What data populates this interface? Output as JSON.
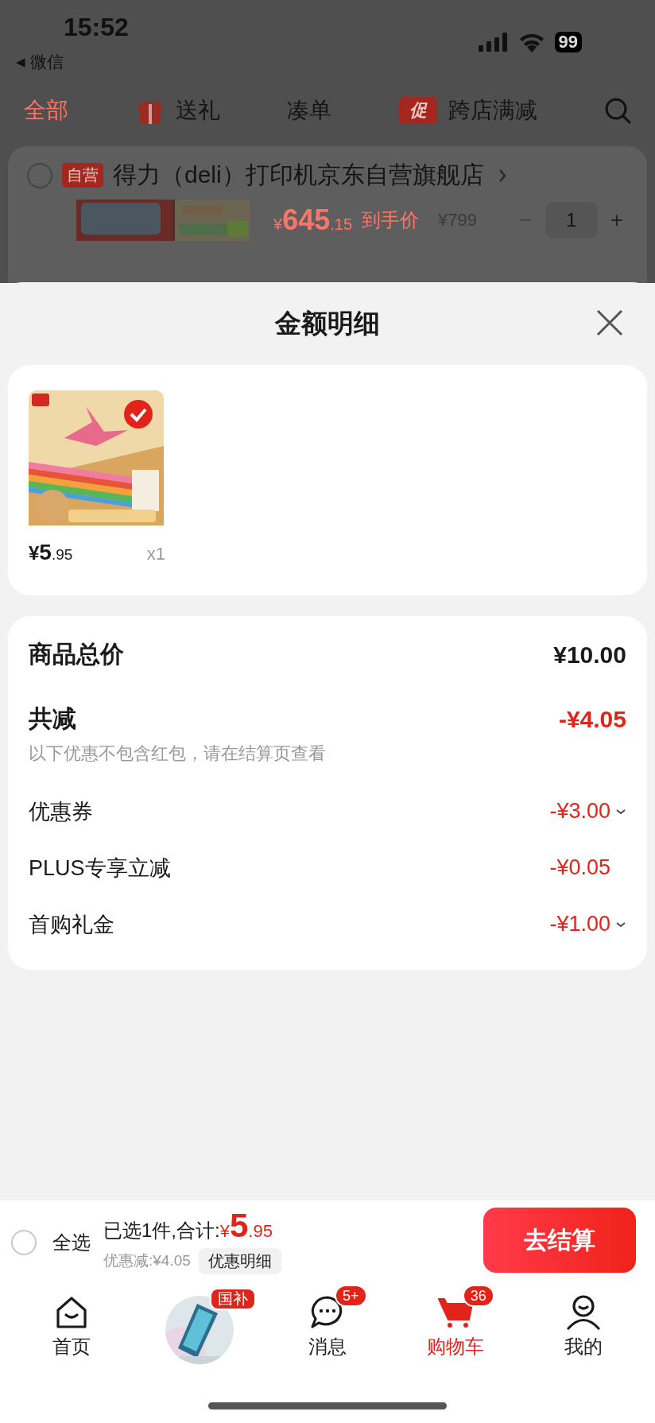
{
  "status_bar": {
    "time": "15:52",
    "back_arrow": "◀",
    "back_label": "微信",
    "battery": "99"
  },
  "filter_tabs": [
    {
      "label": "全部",
      "selected": true,
      "kind": "plain"
    },
    {
      "label": "送礼",
      "selected": false,
      "kind": "gift"
    },
    {
      "label": "凑单",
      "selected": false,
      "kind": "plain"
    },
    {
      "label": "跨店满减",
      "selected": false,
      "kind": "promo",
      "badge": "促"
    }
  ],
  "store": {
    "tag": "自营",
    "name": "得力（deli）打印机京东自营旗舰店",
    "checked": false
  },
  "cart_item": {
    "price_symbol": "¥",
    "price_main": "645",
    "price_decimal": ".15",
    "price_label": "到手价",
    "original_price": "¥799",
    "minus": "−",
    "quantity": "1",
    "plus": "+"
  },
  "sheet": {
    "title": "金额明细",
    "products": [
      {
        "price_symbol": "¥",
        "price_main": "5",
        "price_decimal": ".95",
        "quantity": "x1",
        "checked": true
      }
    ],
    "summary": {
      "total_label": "商品总价",
      "total_value": "¥10.00",
      "discount_label": "共减",
      "discount_value": "-¥4.05",
      "discount_note": "以下优惠不包含红包，请在结算页查看",
      "items": [
        {
          "label": "优惠券",
          "value": "-¥3.00",
          "expandable": true
        },
        {
          "label": "PLUS专享立减",
          "value": "-¥0.05",
          "expandable": false
        },
        {
          "label": "首购礼金",
          "value": "-¥1.00",
          "expandable": true
        }
      ]
    }
  },
  "checkout": {
    "select_all": {
      "label": "全选",
      "checked": false
    },
    "summary_text": "已选1件,合计:",
    "total_symbol": "¥",
    "total_main": "5",
    "total_decimal": ".95",
    "saving": "优惠减:¥4.05",
    "detail_button": "优惠明细",
    "submit": "去结算"
  },
  "nav": [
    {
      "kind": "home",
      "label": "首页",
      "selected": false
    },
    {
      "kind": "promo",
      "badge": "国补",
      "selected": false
    },
    {
      "kind": "message",
      "label": "消息",
      "badge": "5+",
      "selected": false
    },
    {
      "kind": "cart",
      "label": "购物车",
      "badge": "36",
      "selected": true
    },
    {
      "kind": "profile",
      "label": "我的",
      "selected": false
    }
  ]
}
